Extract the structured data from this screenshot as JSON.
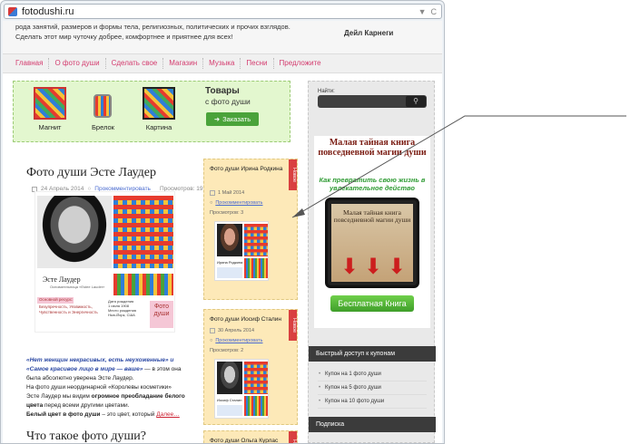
{
  "browser": {
    "url": "fotodushi.ru"
  },
  "topstrip": {
    "line1": "рода занятий, размеров и формы тела, религиозных, политических и прочих взглядов.",
    "line2": "Сделать этот мир чуточку добрее, комфортнее и приятнее для всех!",
    "author": "Дейл Карнеги"
  },
  "nav": {
    "items": [
      "Главная",
      "О фото души",
      "Сделать свое",
      "Магазин",
      "Музыка",
      "Песни",
      "Предложите"
    ]
  },
  "promo": {
    "products": [
      "Магнит",
      "Брелок",
      "Картина"
    ],
    "title": "Товары",
    "subtitle": "с фото души",
    "order": "Заказать"
  },
  "article1": {
    "title": "Фото души Эсте Лаудер",
    "date": "24 Апрель 2014",
    "comment": "Прокомментировать",
    "views": "Просмотров: 19",
    "caption": {
      "name": "Эсте Лаудер",
      "sub": "Основательница «Estee Lauder»",
      "pink": "Основной ресурс:",
      "lines": [
        "Безупречность, Уязвимость,",
        "Чувственность и Энергичность"
      ],
      "date": [
        "Дата рождения",
        "1 июля 1908",
        "Место рождения",
        "Нью-Йорк, США"
      ],
      "logo": "Фото души"
    },
    "text": {
      "p1a": "«Нет женщин некрасивых, есть неухоженные» и «Самое красивое лицо в мире — ваше»",
      "p1b": " — в этом она была абсолютно уверена Эсте Лаудер.",
      "p2": "На фото души неординарной «Королевы косметики» Эсте Лаудер мы видим ",
      "p2b": "огромное преобладание белого цвета",
      "p2c": " перед всеми другими цветами.",
      "p3a": "Белый цвет в фото души",
      "p3b": " – это цвет, который ",
      "more": "Далее…"
    }
  },
  "article2": {
    "title": "Что такое фото души?"
  },
  "cards": [
    {
      "title": "Фото души Ирина Родкина",
      "tag": "Новое",
      "date": "1 Май 2014",
      "comment": "Прокомментировать",
      "views": "Просмотров: 3",
      "thumb_name": "Ирина Родкина"
    },
    {
      "title": "Фото души Иосиф Сталин",
      "tag": "Новое",
      "date": "30 Апрель 2014",
      "comment": "Прокомментировать",
      "views": "Просмотров: 2",
      "thumb_name": "Иосиф Сталин"
    },
    {
      "title": "Фото души Ольга Курлас",
      "tag": "Новое"
    }
  ],
  "sidebar": {
    "search_label": "Найти:",
    "book_title": "Малая тайная книга повседневной магии души",
    "book_green": "Как превратить свою жизнь в увлекательное действо",
    "tablet_text": "Малая тайная книга повседневной магии души",
    "free_btn": "Бесплатная Книга",
    "coupons_head": "Быстрый доступ к купонам",
    "coupons": [
      "Купон на 1 фото души",
      "Купон на 5 фото души",
      "Купон на 10 фото души"
    ],
    "subscribe_head": "Подписка"
  }
}
